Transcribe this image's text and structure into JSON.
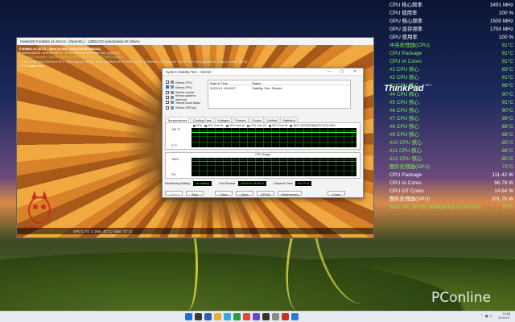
{
  "furmark": {
    "title": "Geeks3D FurMark v1.28.0.0 - [OpenGL] - 1280x720 (windowed) 8X MSAA",
    "osd": {
      "line1": "FurMark v1.28.0.0 - Burn-in test, 1280x720 (8X MSAA)",
      "line2": "Frames:68428 - time:00:06:37 - FPS:170 (min:155, max:182, avg:172)",
      "line3": "> OpenGL renderer: NVIDIA GeForce RTX 3050 Laptop GPU/PCIe/SSE2",
      "line4": "> GPU 1 (NVIDIA GeForce RTX 3050 Laptop GPU) - core: 1500MHz:82°C:99%, mem: 1750MHz, GPU power: 96.8% TDP, limits:[power:0, temp:0, volt:0, OV:0]",
      "line5": "> F1: toggle help"
    },
    "bottom_status": "GPU 1: 71° C (min: 41° C - max: 72° C)",
    "logo_text": "FurMark"
  },
  "sst": {
    "title": "System Stability Test - AIDA64",
    "checks": [
      {
        "label": "Stress CPU",
        "checked": false
      },
      {
        "label": "Stress FPU",
        "checked": true
      },
      {
        "label": "Stress cache",
        "checked": false
      },
      {
        "label": "Stress system memory",
        "checked": false
      },
      {
        "label": "Stress local disks",
        "checked": false
      },
      {
        "label": "Stress GPU(s)",
        "checked": false
      }
    ],
    "table": {
      "col1": "Date & Time",
      "col2": "Status",
      "date": "2022/1/1 15:46:07",
      "status": "Stability Test: Started"
    },
    "tabs": [
      "Temperatures",
      "Cooling Fans",
      "Voltages",
      "Powers",
      "Clocks",
      "Unified",
      "Statistics"
    ],
    "legend": [
      "CPU",
      "CPU Core #1",
      "CPU Core #2",
      "CPU Core #3",
      "CPU Core #4",
      "WDC SN730SDBQNTD-512G-1001"
    ],
    "chart1": {
      "top": "100 °C",
      "bottom": "0 °C"
    },
    "chart2": {
      "title": "CPU Usage",
      "top": "100%",
      "bottom": "0%"
    },
    "status_row": {
      "battery_label": "Remaining Battery:",
      "battery_value": "No battery",
      "started_label": "Test Started:",
      "started_value": "2022/1/1 15:46:07",
      "elapsed_label": "Elapsed Time:",
      "elapsed_value": "00:27:41"
    },
    "buttons": [
      "Start",
      "Stop",
      "Clear",
      "Save",
      "CPUID",
      "Preferences",
      "Close"
    ]
  },
  "hwinfo": [
    {
      "label": "CPU 核心频率",
      "value": "3491 MHz",
      "color": "white"
    },
    {
      "label": "CPU 使用率",
      "value": "100 %",
      "color": "white"
    },
    {
      "label": "GPU 核心频率",
      "value": "1500 MHz",
      "color": "white"
    },
    {
      "label": "GPU 显存频率",
      "value": "1750 MHz",
      "color": "white"
    },
    {
      "label": "GPU 使用率",
      "value": "100 %",
      "color": "white"
    },
    {
      "label": "中央处理器(CPU)",
      "value": "91°C",
      "color": "green"
    },
    {
      "label": "CPU Package",
      "value": "91°C",
      "color": "green"
    },
    {
      "label": "CPU IA Cores",
      "value": "91°C",
      "color": "green"
    },
    {
      "label": "#1 CPU 核心",
      "value": "89°C",
      "color": "green"
    },
    {
      "label": "#2 CPU 核心",
      "value": "91°C",
      "color": "green"
    },
    {
      "label": "#3 CPU 核心",
      "value": "86°C",
      "color": "green"
    },
    {
      "label": "#4 CPU 核心",
      "value": "90°C",
      "color": "green"
    },
    {
      "label": "#5 CPU 核心",
      "value": "91°C",
      "color": "green"
    },
    {
      "label": "#6 CPU 核心",
      "value": "90°C",
      "color": "green"
    },
    {
      "label": "#7 CPU 核心",
      "value": "89°C",
      "color": "green"
    },
    {
      "label": "#8 CPU 核心",
      "value": "89°C",
      "color": "green"
    },
    {
      "label": "#9 CPU 核心",
      "value": "88°C",
      "color": "green"
    },
    {
      "label": "#10 CPU 核心",
      "value": "85°C",
      "color": "green"
    },
    {
      "label": "#11 CPU 核心",
      "value": "86°C",
      "color": "green"
    },
    {
      "label": "#12 CPU 核心",
      "value": "85°C",
      "color": "green"
    },
    {
      "label": "图形处理器(GPU)",
      "value": "73°C",
      "color": "green"
    },
    {
      "label": "CPU Package",
      "value": "111.42 W",
      "color": "white"
    },
    {
      "label": "CPU IA Cores",
      "value": "96.79 W",
      "color": "white"
    },
    {
      "label": "CPU GT Cores",
      "value": "14.64 W",
      "color": "white"
    },
    {
      "label": "图形处理器(GPU)",
      "value": "201.75 W",
      "color": "white"
    },
    {
      "label": "WDC PC SN730 SDBQNTD-512G-1001",
      "value": "37°C",
      "color": "green"
    }
  ],
  "brand": {
    "thinkpad": "ThinkPad",
    "neo": "NEO"
  },
  "watermark": "PConline",
  "taskbar": {
    "time": "15:56",
    "date": "2022/1/1",
    "icon_colors": [
      "#1e6fd9",
      "#3a3a3a",
      "#2b5fb3",
      "#f0a830",
      "#3aa3e3",
      "#2a9a3a",
      "#e04a3a",
      "#6a4ac0",
      "#333333",
      "#8a8a8a",
      "#c8321e",
      "#2a7adf"
    ]
  }
}
